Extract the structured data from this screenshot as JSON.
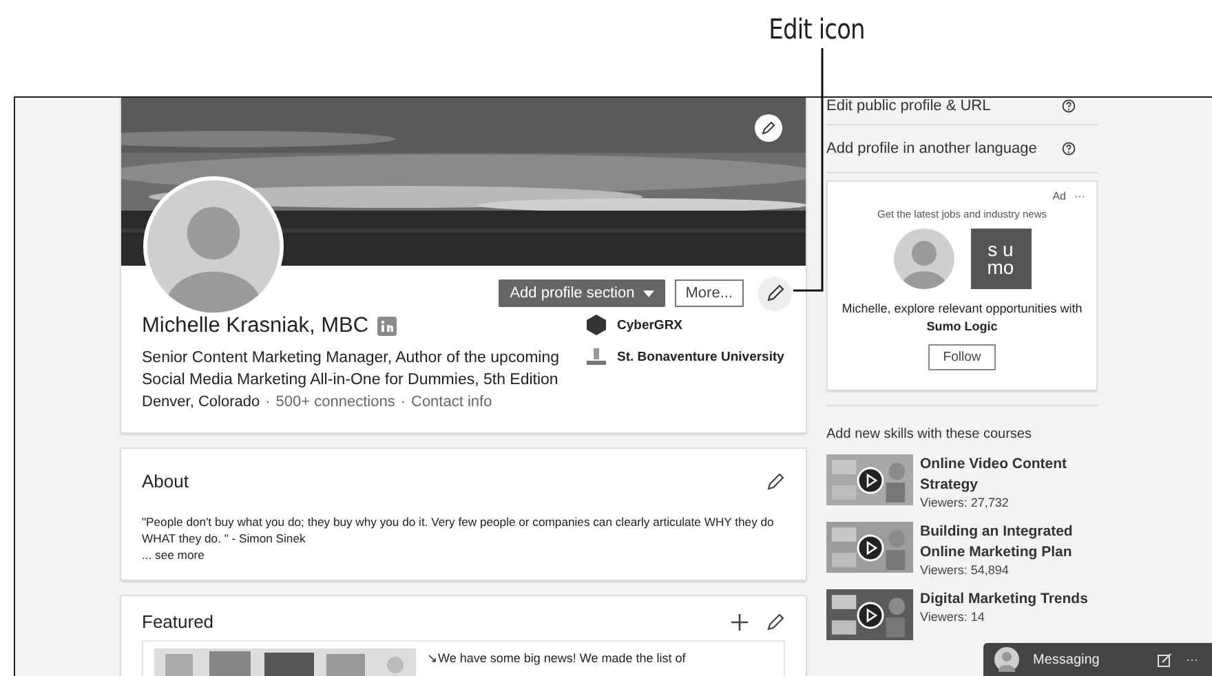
{
  "callout": {
    "label": "Edit icon"
  },
  "profile": {
    "name": "Michelle Krasniak, MBC",
    "headline": "Senior Content Marketing Manager, Author of the upcoming Social Media Marketing All-in-One for Dummies, 5th Edition",
    "location": "Denver, Colorado",
    "separator": "·",
    "connections": "500+ connections",
    "contact": "Contact info",
    "add_section_button": "Add profile section",
    "more_button": "More...",
    "organizations": [
      {
        "kind": "company",
        "name": "CyberGRX"
      },
      {
        "kind": "school",
        "name": "St. Bonaventure University"
      }
    ]
  },
  "about": {
    "title": "About",
    "text": "\"People don't buy what you do; they buy why you do it. Very few people or companies can clearly articulate WHY they do WHAT they do. \" - Simon Sinek",
    "see_more": "... see more"
  },
  "featured": {
    "title": "Featured",
    "post_text": "↘We have some big news! We made the list of"
  },
  "sidebar": {
    "links": [
      {
        "label": "Edit public profile & URL"
      },
      {
        "label": "Add profile in another language"
      }
    ],
    "ad": {
      "label": "Ad",
      "menu": "···",
      "tagline": "Get the latest jobs and industry news",
      "logo_line_1": "s u",
      "logo_line_2": "mo",
      "message": "Michelle, explore relevant opportunities with **Sumo Logic**",
      "follow_button": "Follow"
    },
    "courses_title": "Add new skills with these courses",
    "courses": [
      {
        "title": "Online Video Content Strategy",
        "viewers": "Viewers: 27,732"
      },
      {
        "title": "Building an Integrated Online Marketing Plan",
        "viewers": "Viewers: 54,894"
      },
      {
        "title": "Digital Marketing Trends",
        "viewers": "Viewers: 14"
      }
    ]
  },
  "messaging": {
    "label": "Messaging",
    "menu": "···"
  }
}
